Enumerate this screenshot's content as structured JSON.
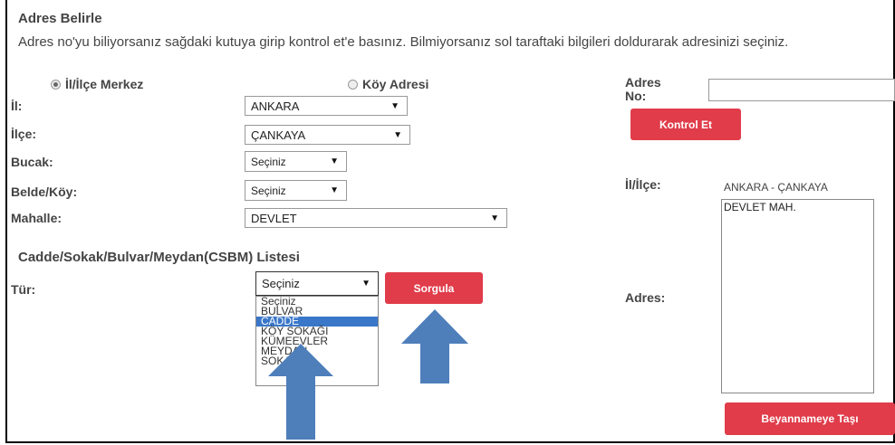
{
  "form": {
    "title": "Adres Belirle",
    "description": "Adres no'yu biliyorsanız sağdaki kutuya girip kontrol et'e basınız. Bilmiyorsanız sol taraftaki bilgileri doldurarak adresinizi seçiniz.",
    "radio_merkez": "İl/İlçe Merkez",
    "radio_koy": "Köy Adresi",
    "il_label": "İl:",
    "il_value": "ANKARA",
    "ilce_label": "İlçe:",
    "ilce_value": "ÇANKAYA",
    "bucak_label": "Bucak:",
    "bucak_value": "Seçiniz",
    "belde_label": "Belde/Köy:",
    "belde_value": "Seçiniz",
    "mahalle_label": "Mahalle:",
    "mahalle_value": "DEVLET",
    "csbm_title": "Cadde/Sokak/Bulvar/Meydan(CSBM) Listesi",
    "tur_label": "Tür:",
    "tur_value": "Seçiniz",
    "tur_options": [
      "Seçiniz",
      "BULVAR",
      "CADDE",
      "KÖY SOKAĞI",
      "KÜMEEVLER",
      "MEYDAN",
      "SOKAK"
    ],
    "sorgula_label": "Sorgula"
  },
  "right": {
    "adres_no_label": "Adres No:",
    "kontrol_label": "Kontrol Et",
    "ililce_label": "İl/İlçe:",
    "ililce_value": "ANKARA - ÇANKAYA",
    "adres_label": "Adres:",
    "adres_value": "DEVLET MAH.",
    "beyanname_label": "Beyannameye Taşı"
  },
  "colors": {
    "accent": "#e03c4a",
    "arrow": "#4e7fbb",
    "highlight": "#3a77c9"
  }
}
